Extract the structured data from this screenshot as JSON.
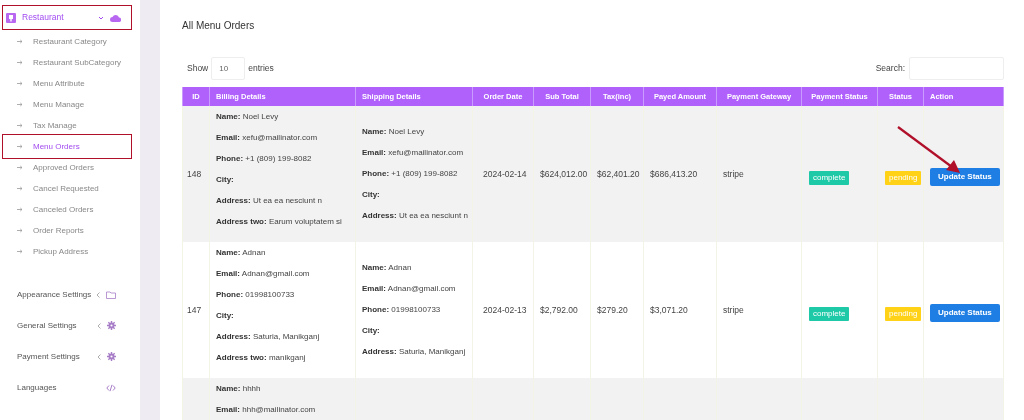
{
  "sidebar": {
    "group": {
      "label": "Restaurant",
      "expanded": true,
      "highlighted": true,
      "items": [
        {
          "label": "Restaurant Category",
          "selected": false,
          "highlighted": false
        },
        {
          "label": "Restaurant SubCategory",
          "selected": false,
          "highlighted": false
        },
        {
          "label": "Menu Attribute",
          "selected": false,
          "highlighted": false
        },
        {
          "label": "Menu Manage",
          "selected": false,
          "highlighted": false
        },
        {
          "label": "Tax Manage",
          "selected": false,
          "highlighted": false
        },
        {
          "label": "Menu Orders",
          "selected": true,
          "highlighted": true
        },
        {
          "label": "Approved Orders",
          "selected": false,
          "highlighted": false
        },
        {
          "label": "Cancel Requested",
          "selected": false,
          "highlighted": false
        },
        {
          "label": "Canceled Orders",
          "selected": false,
          "highlighted": false
        },
        {
          "label": "Order Reports",
          "selected": false,
          "highlighted": false
        },
        {
          "label": "Pickup Address",
          "selected": false,
          "highlighted": false
        }
      ]
    },
    "sections": [
      {
        "label": "Appearance Settings",
        "kind": "folder",
        "expandable": true
      },
      {
        "label": "General Settings",
        "kind": "gear",
        "expandable": true
      },
      {
        "label": "Payment Settings",
        "kind": "gear",
        "expandable": true
      },
      {
        "label": "Languages",
        "kind": "code",
        "expandable": false
      }
    ]
  },
  "page_title": "All Menu Orders",
  "length_control": {
    "before": "Show",
    "value": "10",
    "after": "entries"
  },
  "search": {
    "label": "Search:"
  },
  "table": {
    "columns": [
      "ID",
      "Billing Details",
      "Shipping Details",
      "Order Date",
      "Sub Total",
      "Tax(inc)",
      "Payed Amount",
      "Payment Gateway",
      "Payment Status",
      "Status",
      "Action"
    ],
    "rows": [
      {
        "id": "148",
        "billing": [
          {
            "label": "Name:",
            "value": "Noel Levy"
          },
          {
            "label": "Email:",
            "value": "xefu@mailinator.com"
          },
          {
            "label": "Phone:",
            "value": "+1 (809) 199-8082"
          },
          {
            "label": "City:"
          },
          {
            "label": "Address:",
            "value": "Ut ea ea nesciunt n"
          },
          {
            "label": "Address two:",
            "value": "Earum voluptatem si"
          }
        ],
        "shipping": [
          {
            "label": "Name:",
            "value": "Noel Levy"
          },
          {
            "label": "Email:",
            "value": "xefu@mailinator.com"
          },
          {
            "label": "Phone:",
            "value": "+1 (809) 199-8082"
          },
          {
            "label": "City:"
          },
          {
            "label": "Address:",
            "value": "Ut ea ea nesciunt n"
          }
        ],
        "order_date": "2024-02-14",
        "sub_total": "$624,012.00",
        "tax": "$62,401.20",
        "payed_amount": "$686,413.20",
        "gateway": "stripe",
        "payment_status": {
          "text": "complete",
          "color": "#1ec9a8"
        },
        "status": {
          "text": "pending",
          "color": "#ffd117"
        },
        "action": "Update Status"
      },
      {
        "id": "147",
        "billing": [
          {
            "label": "Name:",
            "value": "Adnan"
          },
          {
            "label": "Email:",
            "value": "Adnan@gmail.com"
          },
          {
            "label": "Phone:",
            "value": "01998100733"
          },
          {
            "label": "City:"
          },
          {
            "label": "Address:",
            "value": "Saturia, Manikganj"
          },
          {
            "label": "Address two:",
            "value": "manikganj"
          }
        ],
        "shipping": [
          {
            "label": "Name:",
            "value": "Adnan"
          },
          {
            "label": "Email:",
            "value": "Adnan@gmail.com"
          },
          {
            "label": "Phone:",
            "value": "01998100733"
          },
          {
            "label": "City:"
          },
          {
            "label": "Address:",
            "value": "Saturia, Manikganj"
          }
        ],
        "order_date": "2024-02-13",
        "sub_total": "$2,792.00",
        "tax": "$279.20",
        "payed_amount": "$3,071.20",
        "gateway": "stripe",
        "payment_status": {
          "text": "complete",
          "color": "#1ec9a8"
        },
        "status": {
          "text": "pending",
          "color": "#ffd117"
        },
        "action": "Update Status"
      },
      {
        "billing": [
          {
            "label": "Name:",
            "value": "hhhh"
          },
          {
            "label": "Email:",
            "value": "hhh@mailinator.com"
          }
        ]
      }
    ]
  }
}
